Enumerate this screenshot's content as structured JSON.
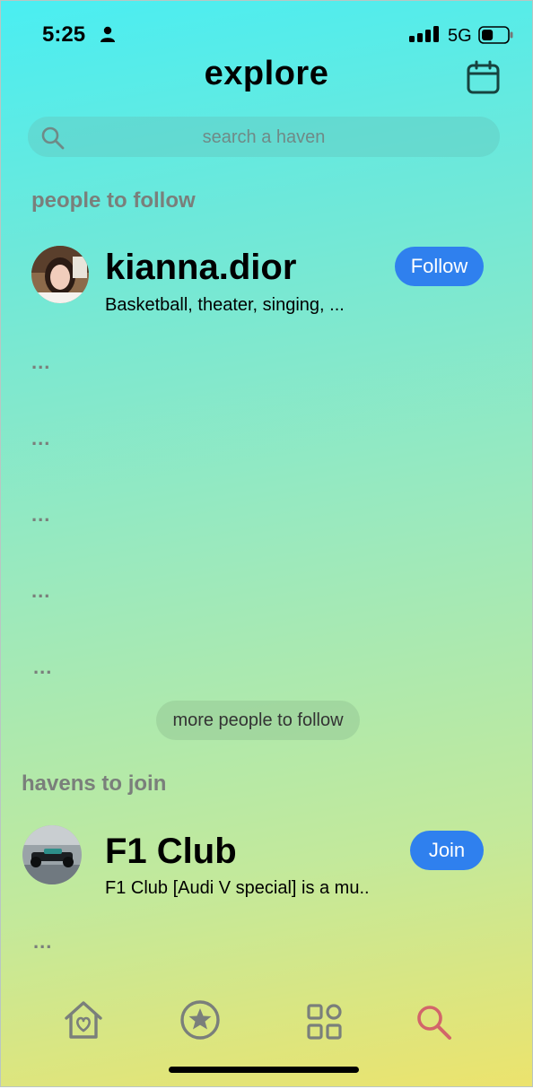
{
  "status": {
    "time": "5:25",
    "network": "5G",
    "battery_level": 0.45
  },
  "header": {
    "title": "explore"
  },
  "search": {
    "placeholder": "search a haven"
  },
  "people_section": {
    "title": "people to follow",
    "people": [
      {
        "username": "kianna.dior",
        "interests": "Basketball, theater, singing, ...",
        "follow_label": "Follow"
      }
    ],
    "placeholder_rows": [
      "...",
      "...",
      "...",
      "...",
      "..."
    ],
    "more_label": "more people to follow"
  },
  "havens_section": {
    "title": "havens to join",
    "havens": [
      {
        "name": "F1 Club",
        "description": "F1 Club [Audi V special] is a mu..",
        "join_label": "Join"
      }
    ],
    "placeholder_rows": [
      "..."
    ]
  },
  "bottom_nav": {
    "items": [
      {
        "icon": "home-heart-icon",
        "active": false
      },
      {
        "icon": "star-icon",
        "active": false
      },
      {
        "icon": "grid-icon",
        "active": false
      },
      {
        "icon": "search-icon",
        "active": true
      }
    ],
    "inactive_color": "#7a7f7b",
    "active_color": "#d2656a"
  },
  "colors": {
    "primary_button": "#2f80ee"
  }
}
